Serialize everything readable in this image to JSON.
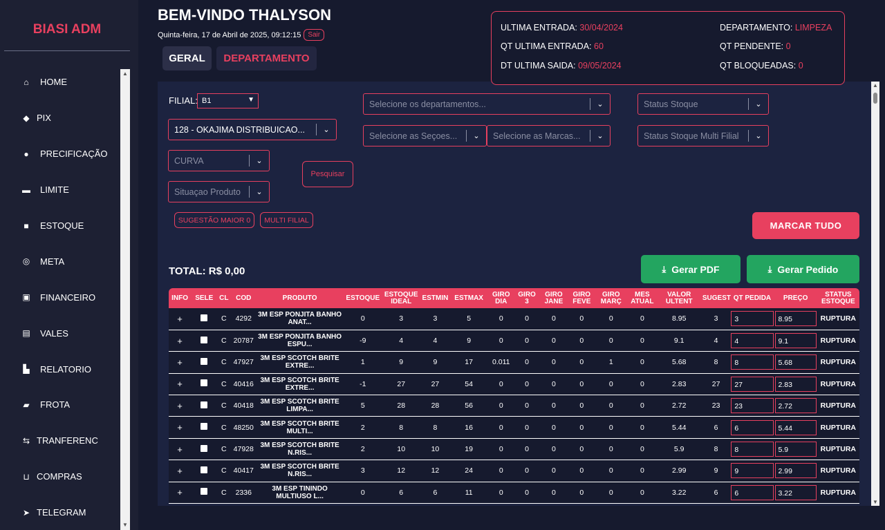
{
  "sidebar": {
    "brand": "BIASI ADM",
    "items": [
      {
        "label": "HOME",
        "icon": "home-icon",
        "glyph": "⌂"
      },
      {
        "label": "PIX",
        "icon": "pix-icon",
        "glyph": "◆"
      },
      {
        "label": "PRECIFICAÇÃO",
        "icon": "tags-icon",
        "glyph": "●"
      },
      {
        "label": "LIMITE",
        "icon": "credit-card-icon",
        "glyph": "▬"
      },
      {
        "label": "ESTOQUE",
        "icon": "box-icon",
        "glyph": "■"
      },
      {
        "label": "META",
        "icon": "target-icon",
        "glyph": "◎"
      },
      {
        "label": "FINANCEIRO",
        "icon": "money-icon",
        "glyph": "▣"
      },
      {
        "label": "VALES",
        "icon": "receipt-icon",
        "glyph": "▤"
      },
      {
        "label": "RELATORIO",
        "icon": "chart-icon",
        "glyph": "▙"
      },
      {
        "label": "FROTA",
        "icon": "truck-icon",
        "glyph": "▰"
      },
      {
        "label": "TRANFERENC",
        "icon": "transfer-icon",
        "glyph": "⇆"
      },
      {
        "label": "COMPRAS",
        "icon": "cart-icon",
        "glyph": "⊔"
      },
      {
        "label": "TELEGRAM",
        "icon": "telegram-icon",
        "glyph": "➤"
      }
    ]
  },
  "header": {
    "welcome": "BEM-VINDO THALYSON",
    "date": "Quinta-feira, 17 de Abril de 2025, 09:12:15",
    "logout": "Sair",
    "tabs": [
      "GERAL",
      "DEPARTAMENTO"
    ]
  },
  "info": {
    "ultima_entrada_label": "ULTIMA ENTRADA:",
    "ultima_entrada": "30/04/2024",
    "qt_ultima_entrada_label": "QT ULTIMA ENTRADA:",
    "qt_ultima_entrada": "60",
    "dt_ultima_saida_label": "DT ULTIMA SAIDA:",
    "dt_ultima_saida": "09/05/2024",
    "departamento_label": "DEPARTAMENTO:",
    "departamento": "LIMPEZA",
    "qt_pendente_label": "QT PENDENTE:",
    "qt_pendente": "0",
    "qt_bloqueadas_label": "QT BLOQUEADAS:",
    "qt_bloqueadas": "0"
  },
  "filters": {
    "filial_label": "FILIAL:",
    "filial_value": "B1",
    "fornecedor": "128 - OKAJIMA DISTRIBUICAO...",
    "curva": "CURVA",
    "situacao": "Situaçao Produto",
    "departamentos": "Selecione os departamentos...",
    "secoes": "Selecione as Seçoes...",
    "marcas": "Selecione as Marcas...",
    "status_estoque": "Status Stoque",
    "status_multi": "Status Stoque Multi Filial",
    "pesquisar": "Pesquisar",
    "sugestao": "SUGESTÃO MAIOR 0",
    "multi_filial": "MULTI FILIAL"
  },
  "actions": {
    "marcar_tudo": "MARCAR TUDO",
    "total": "TOTAL: R$ 0,00",
    "gerar_pdf": "Gerar PDF",
    "gerar_pedido": "Gerar Pedido"
  },
  "table": {
    "headers": [
      "INFO",
      "SELE",
      "CL",
      "COD",
      "PRODUTO",
      "ESTOQUE",
      "ESTOQUE IDEAL",
      "ESTMIN",
      "ESTMAX",
      "GIRO DIA",
      "GIRO 3",
      "GIRO JANE",
      "GIRO FEVE",
      "GIRO MARÇ",
      "MES ATUAL",
      "VALOR ULTENT",
      "SUGEST",
      "QT PEDIDA",
      "PREÇO",
      "STATUS ESTOQUE"
    ],
    "rows": [
      {
        "info": "+",
        "cl": "C",
        "cod": "4292",
        "produto": "3M ESP PONJITA BANHO ANAT...",
        "estoque": "0",
        "ideal": "3",
        "estmin": "3",
        "estmax": "5",
        "giro_dia": "0",
        "giro3": "0",
        "jane": "0",
        "feve": "0",
        "marc": "0",
        "mes": "0",
        "valor": "8.95",
        "sugest": "3",
        "qt": "3",
        "preco": "8.95",
        "status": "RUPTURA"
      },
      {
        "info": "+",
        "cl": "C",
        "cod": "20787",
        "produto": "3M ESP PONJITA BANHO ESPU...",
        "estoque": "-9",
        "ideal": "4",
        "estmin": "4",
        "estmax": "9",
        "giro_dia": "0",
        "giro3": "0",
        "jane": "0",
        "feve": "0",
        "marc": "0",
        "mes": "0",
        "valor": "9.1",
        "sugest": "4",
        "qt": "4",
        "preco": "9.1",
        "status": "RUPTURA"
      },
      {
        "info": "+",
        "cl": "C",
        "cod": "47927",
        "produto": "3M ESP SCOTCH BRITE EXTRE...",
        "estoque": "1",
        "ideal": "9",
        "estmin": "9",
        "estmax": "17",
        "giro_dia": "0.011",
        "giro3": "0",
        "jane": "0",
        "feve": "0",
        "marc": "1",
        "mes": "0",
        "valor": "5.68",
        "sugest": "8",
        "qt": "8",
        "preco": "5.68",
        "status": "RUPTURA"
      },
      {
        "info": "+",
        "cl": "C",
        "cod": "40416",
        "produto": "3M ESP SCOTCH BRITE EXTRE...",
        "estoque": "-1",
        "ideal": "27",
        "estmin": "27",
        "estmax": "54",
        "giro_dia": "0",
        "giro3": "0",
        "jane": "0",
        "feve": "0",
        "marc": "0",
        "mes": "0",
        "valor": "2.83",
        "sugest": "27",
        "qt": "27",
        "preco": "2.83",
        "status": "RUPTURA"
      },
      {
        "info": "+",
        "cl": "C",
        "cod": "40418",
        "produto": "3M ESP SCOTCH BRITE LIMPA...",
        "estoque": "5",
        "ideal": "28",
        "estmin": "28",
        "estmax": "56",
        "giro_dia": "0",
        "giro3": "0",
        "jane": "0",
        "feve": "0",
        "marc": "0",
        "mes": "0",
        "valor": "2.72",
        "sugest": "23",
        "qt": "23",
        "preco": "2.72",
        "status": "RUPTURA"
      },
      {
        "info": "+",
        "cl": "C",
        "cod": "48250",
        "produto": "3M ESP SCOTCH BRITE MULTI...",
        "estoque": "2",
        "ideal": "8",
        "estmin": "8",
        "estmax": "16",
        "giro_dia": "0",
        "giro3": "0",
        "jane": "0",
        "feve": "0",
        "marc": "0",
        "mes": "0",
        "valor": "5.44",
        "sugest": "6",
        "qt": "6",
        "preco": "5.44",
        "status": "RUPTURA"
      },
      {
        "info": "+",
        "cl": "C",
        "cod": "47928",
        "produto": "3M ESP SCOTCH BRITE N.RIS...",
        "estoque": "2",
        "ideal": "10",
        "estmin": "10",
        "estmax": "19",
        "giro_dia": "0",
        "giro3": "0",
        "jane": "0",
        "feve": "0",
        "marc": "0",
        "mes": "0",
        "valor": "5.9",
        "sugest": "8",
        "qt": "8",
        "preco": "5.9",
        "status": "RUPTURA"
      },
      {
        "info": "+",
        "cl": "C",
        "cod": "40417",
        "produto": "3M ESP SCOTCH BRITE N.RIS...",
        "estoque": "3",
        "ideal": "12",
        "estmin": "12",
        "estmax": "24",
        "giro_dia": "0",
        "giro3": "0",
        "jane": "0",
        "feve": "0",
        "marc": "0",
        "mes": "0",
        "valor": "2.99",
        "sugest": "9",
        "qt": "9",
        "preco": "2.99",
        "status": "RUPTURA"
      },
      {
        "info": "+",
        "cl": "C",
        "cod": "2336",
        "produto": "3M ESP TININDO MULTIUSO L...",
        "estoque": "0",
        "ideal": "6",
        "estmin": "6",
        "estmax": "11",
        "giro_dia": "0",
        "giro3": "0",
        "jane": "0",
        "feve": "0",
        "marc": "0",
        "mes": "0",
        "valor": "3.22",
        "sugest": "6",
        "qt": "6",
        "preco": "3.22",
        "status": "RUPTURA"
      }
    ]
  },
  "colors": {
    "accent": "#e8405f",
    "background": "#161a2e",
    "sidebar": "#1d2033",
    "panel": "#1c2340",
    "success": "#23a560"
  }
}
